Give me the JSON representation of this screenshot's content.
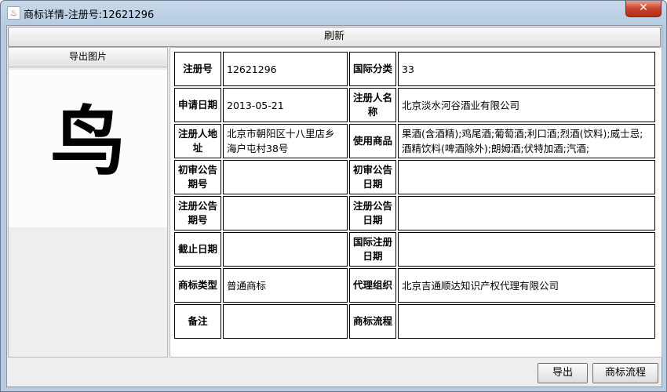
{
  "window": {
    "title": "商标详情-注册号:12621296",
    "close_label": "✕"
  },
  "toolbar": {
    "refresh_label": "刷新"
  },
  "left_panel": {
    "export_image_label": "导出图片",
    "logo_char": "鸟"
  },
  "details": {
    "rows": [
      {
        "l1": "注册号",
        "v1": "12621296",
        "l2": "国际分类",
        "v2": "33"
      },
      {
        "l1": "申请日期",
        "v1": "2013-05-21",
        "l2": "注册人名称",
        "v2": "北京淡水河谷酒业有限公司"
      },
      {
        "l1": "注册人地址",
        "v1": "北京市朝阳区十八里店乡海户屯村38号",
        "l2": "使用商品",
        "v2": "果酒(含酒精);鸡尾酒;葡萄酒;利口酒;烈酒(饮料);威士忌;酒精饮料(啤酒除外);朗姆酒;伏特加酒;汽酒;"
      },
      {
        "l1": "初审公告期号",
        "v1": "",
        "l2": "初审公告日期",
        "v2": ""
      },
      {
        "l1": "注册公告期号",
        "v1": "",
        "l2": "注册公告日期",
        "v2": ""
      },
      {
        "l1": "截止日期",
        "v1": "",
        "l2": "国际注册日期",
        "v2": ""
      },
      {
        "l1": "商标类型",
        "v1": "普通商标",
        "l2": "代理组织",
        "v2": "北京吉通顺达知识产权代理有限公司"
      },
      {
        "l1": "备注",
        "v1": "",
        "l2": "商标流程",
        "v2": ""
      }
    ]
  },
  "footer": {
    "export_label": "导出",
    "flow_label": "商标流程"
  }
}
